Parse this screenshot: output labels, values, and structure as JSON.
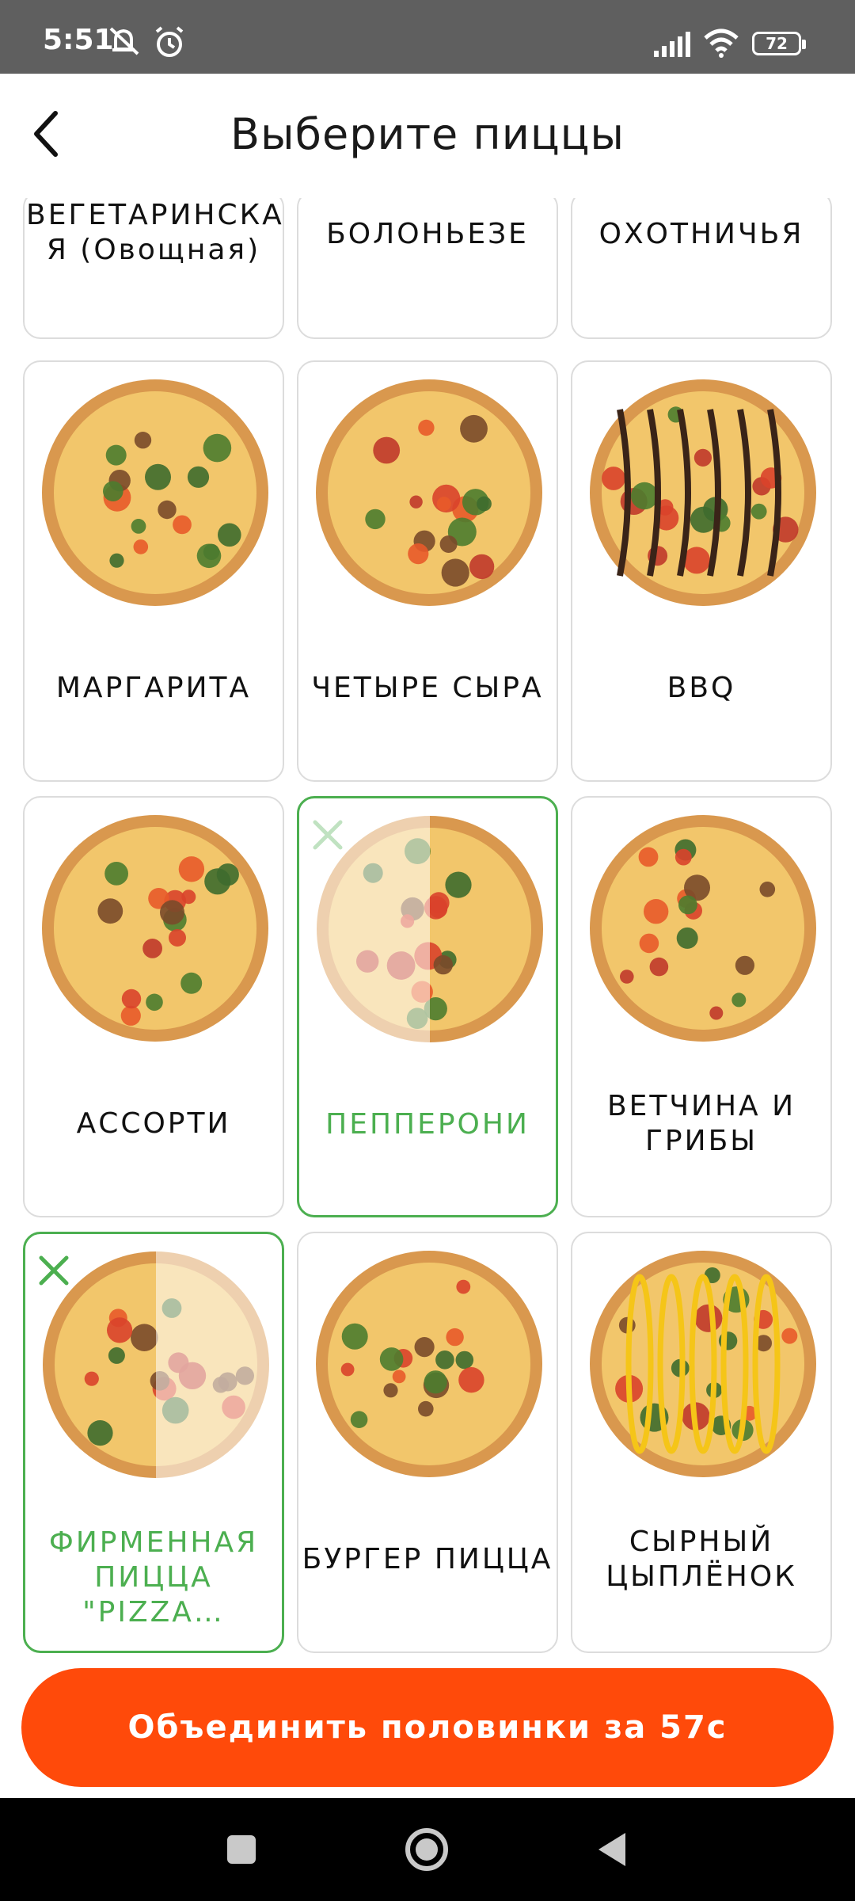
{
  "status": {
    "time": "5:51",
    "battery": "72"
  },
  "header": {
    "title": "Выберите пиццы"
  },
  "pizzas": [
    {
      "name": "ВЕГЕТАРИНСКА\nЯ (Овощная)"
    },
    {
      "name": "БОЛОНЬЕЗЕ"
    },
    {
      "name": "ОХОТНИЧЬЯ"
    },
    {
      "name": "МАРГАРИТА"
    },
    {
      "name": "ЧЕТЫРЕ СЫРА"
    },
    {
      "name": "BBQ"
    },
    {
      "name": "АССОРТИ"
    },
    {
      "name": "ПЕППЕРОНИ",
      "selected": true
    },
    {
      "name": "ВЕТЧИНА  И\nГРИБЫ"
    },
    {
      "name": "ФИРМЕННАЯ\nПИЦЦА \"PIZZA…",
      "selected": true
    },
    {
      "name": "БУРГЕР ПИЦЦА"
    },
    {
      "name": "СЫРНЫЙ\nЦЫПЛЁНОК"
    }
  ],
  "cta": {
    "label": "Объединить половинки за 57с"
  },
  "colors": {
    "accent": "#ff4a0a",
    "selected": "#4caf50",
    "crust": "#d9984e",
    "cheese": "#f2c66b"
  }
}
